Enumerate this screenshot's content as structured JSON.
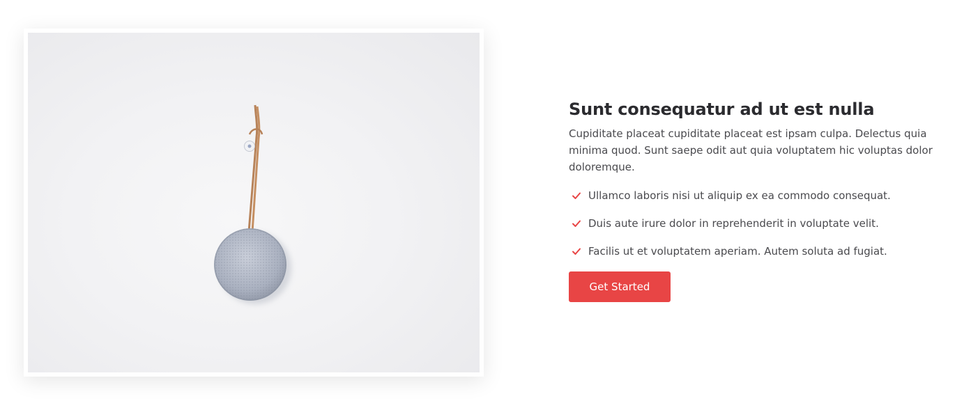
{
  "about": {
    "title": "Sunt consequatur ad ut est nulla",
    "description": "Cupiditate placeat cupiditate placeat est ipsam culpa. Delectus quia minima quod. Sunt saepe odit aut quia voluptatem hic voluptas dolor doloremque.",
    "features": [
      {
        "icon": "check-icon",
        "text": "Ullamco laboris nisi ut aliquip ex ea commodo consequat."
      },
      {
        "icon": "check-icon",
        "text": "Duis aute irure dolor in reprehenderit in voluptate velit."
      },
      {
        "icon": "check-icon",
        "text": "Facilis ut et voluptatem aperiam. Autem soluta ad fugiat."
      }
    ],
    "cta_label": "Get Started"
  },
  "colors": {
    "accent": "#e84545",
    "heading": "#2b2b2f",
    "body_text": "#4a4a4e"
  }
}
